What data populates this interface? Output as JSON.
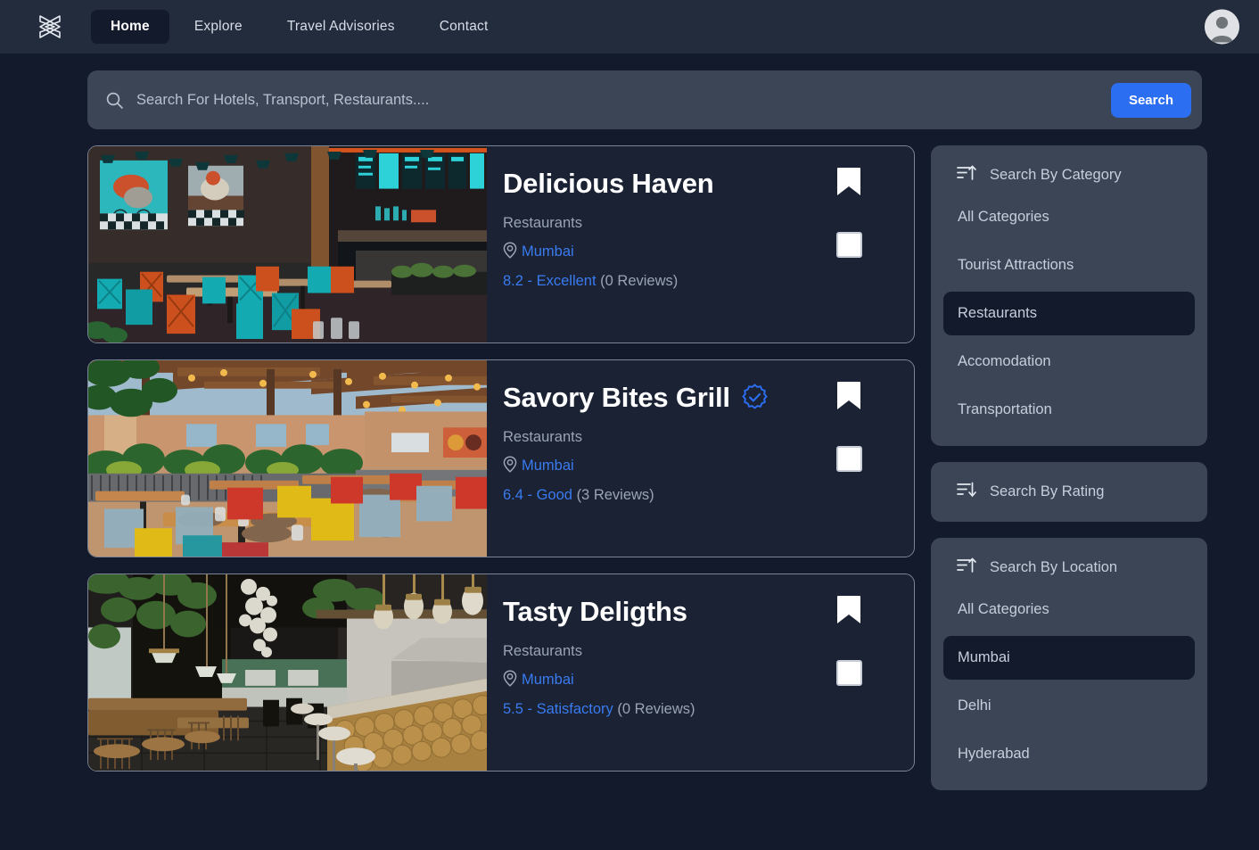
{
  "navbar": {
    "logo_icon": "crossed-ribbon-logo-icon",
    "links": [
      {
        "label": "Home",
        "active": true
      },
      {
        "label": "Explore",
        "active": false
      },
      {
        "label": "Travel Advisories",
        "active": false
      },
      {
        "label": "Contact",
        "active": false
      }
    ],
    "avatar_icon": "user-avatar-icon"
  },
  "search": {
    "icon": "search-icon",
    "placeholder": "Search For Hotels, Transport, Restaurants....",
    "value": "",
    "button_label": "Search"
  },
  "results": [
    {
      "title": "Delicious Haven",
      "verified": false,
      "category": "Restaurants",
      "location": "Mumbai",
      "rating_text": "8.2 - Excellent",
      "reviews_text": "(0 Reviews)",
      "image_alt": "restaurant-interior-teal-orange-chairs",
      "bookmark_icon": "bookmark-icon",
      "select_checkbox": "compare-checkbox"
    },
    {
      "title": "Savory Bites Grill",
      "verified": true,
      "verified_icon": "verified-badge-icon",
      "category": "Restaurants",
      "location": "Mumbai",
      "rating_text": "6.4 - Good",
      "reviews_text": "(3 Reviews)",
      "image_alt": "outdoor-patio-restaurant-colorful-chairs",
      "bookmark_icon": "bookmark-icon",
      "select_checkbox": "compare-checkbox"
    },
    {
      "title": "Tasty Deligths",
      "verified": false,
      "category": "Restaurants",
      "location": "Mumbai",
      "rating_text": "5.5 - Satisfactory",
      "reviews_text": "(0 Reviews)",
      "image_alt": "modern-bistro-hanging-plants-gold-bar",
      "bookmark_icon": "bookmark-icon",
      "select_checkbox": "compare-checkbox"
    }
  ],
  "sidebar": {
    "category_panel": {
      "icon": "sort-ascending-icon",
      "title": "Search By Category",
      "items": [
        {
          "label": "All Categories",
          "selected": false
        },
        {
          "label": "Tourist Attractions",
          "selected": false
        },
        {
          "label": "Restaurants",
          "selected": true
        },
        {
          "label": "Accomodation",
          "selected": false
        },
        {
          "label": "Transportation",
          "selected": false
        }
      ]
    },
    "rating_panel": {
      "icon": "sort-descending-icon",
      "title": "Search By Rating",
      "items": []
    },
    "location_panel": {
      "icon": "sort-ascending-icon",
      "title": "Search By Location",
      "items": [
        {
          "label": "All Categories",
          "selected": false
        },
        {
          "label": "Mumbai",
          "selected": true
        },
        {
          "label": "Delhi",
          "selected": false
        },
        {
          "label": "Hyderabad",
          "selected": false
        }
      ]
    }
  },
  "colors": {
    "page_bg": "#131a2b",
    "navbar_bg": "#232c3d",
    "panel_bg": "#3b4556",
    "card_bg": "#1a2233",
    "accent_blue": "#2c6ef2",
    "link_blue": "#3a7bf0",
    "muted_text": "#9aa4b3"
  }
}
